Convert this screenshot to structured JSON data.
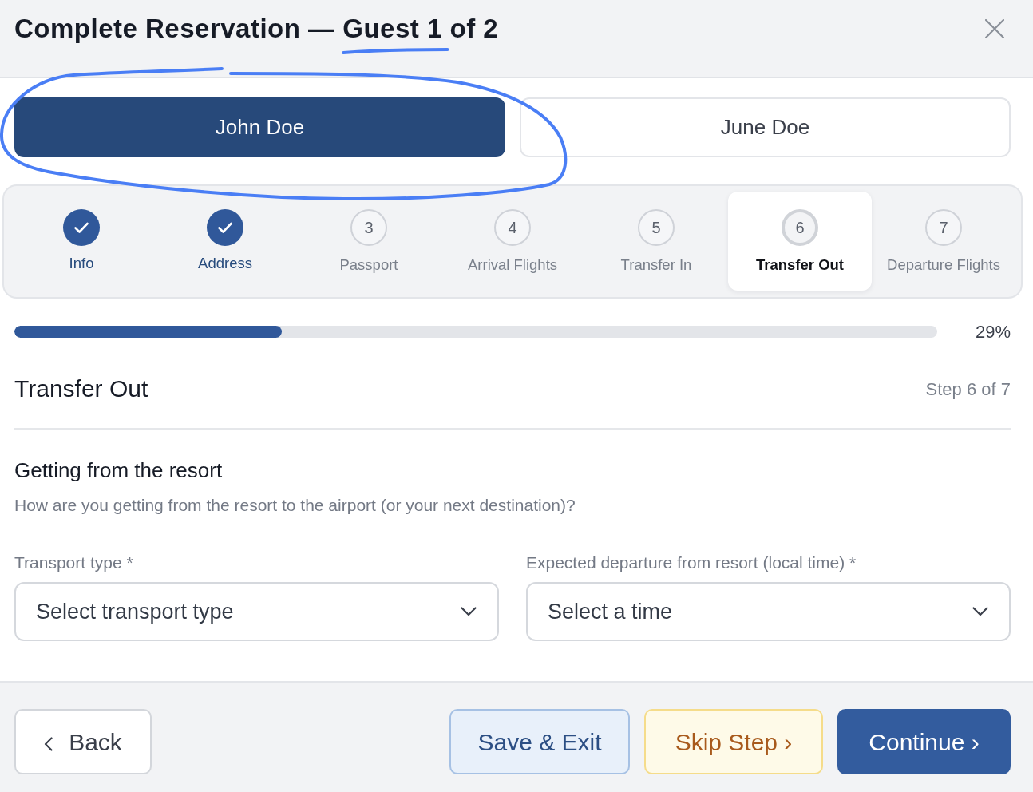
{
  "window": {
    "title": "Complete Reservation — Guest 1 of 2",
    "underlined": true
  },
  "guests": [
    {
      "name": "John Doe",
      "selected": true,
      "circled": true
    },
    {
      "name": "June Doe",
      "selected": false,
      "circled": false
    }
  ],
  "steps": [
    {
      "label": "Info",
      "completed": true,
      "selected": false
    },
    {
      "label": "Address",
      "completed": true,
      "selected": false
    },
    {
      "number": "3",
      "label": "Passport",
      "completed": false,
      "selected": false
    },
    {
      "number": "4",
      "label": "Arrival Flights",
      "completed": false,
      "selected": false
    },
    {
      "number": "5",
      "label": "Transfer In",
      "completed": false,
      "selected": false
    },
    {
      "number": "6",
      "label": "Transfer Out",
      "completed": false,
      "selected": true
    },
    {
      "number": "7",
      "label": "Departure Flights",
      "completed": false,
      "selected": false
    }
  ],
  "progress": {
    "level": 0.29,
    "reading": "29%"
  },
  "section": {
    "title": "Transfer Out",
    "step": "Step 6 of 7"
  },
  "group": {
    "heading": "Getting from the resort",
    "description": "How are you getting from the resort to the airport (or your next destination)?"
  },
  "fields": [
    {
      "label": "Transport type *",
      "placeholder": "Select transport type"
    },
    {
      "label": "Expected departure from resort (local time) *",
      "placeholder": "Select a time"
    }
  ],
  "footer": {
    "back": {
      "label": "Back"
    },
    "actions": [
      {
        "label": "Save & Exit",
        "kind": "secondary"
      },
      {
        "label": "Skip Step ›",
        "kind": "skip"
      },
      {
        "label": "Continue ›",
        "kind": "primary"
      }
    ]
  }
}
